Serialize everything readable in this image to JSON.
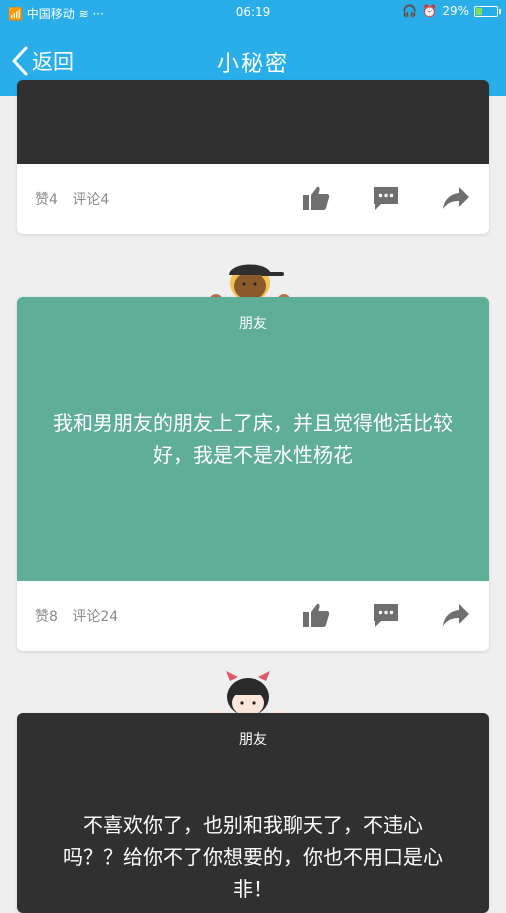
{
  "status_bar": {
    "carrier": "中国移动",
    "time": "06:19",
    "battery": "29%",
    "battery_level": 0.29
  },
  "nav": {
    "back_label": "返回",
    "title": "小秘密"
  },
  "colors": {
    "header": "#29aee9",
    "card_green": "#5fae97",
    "card_dark": "#303030",
    "icon_gray": "#6f6f6f"
  },
  "posts": [
    {
      "likes": "赞4",
      "comments": "评论4",
      "body_color": "#303030"
    },
    {
      "tag": "朋友",
      "text": "我和男朋友的朋友上了床，并且觉得他活比较好，我是不是水性杨花",
      "likes": "赞8",
      "comments": "评论24",
      "body_color": "#5fae97",
      "avatar": "boy-cap-avatar"
    },
    {
      "tag": "朋友",
      "text": "不喜欢你了，也别和我聊天了，不违心吗？？给你不了你想要的，你也不用口是心非！",
      "body_color": "#303030",
      "avatar": "girl-cat-ears-avatar"
    }
  ],
  "icons": [
    "thumbs-up-icon",
    "comment-icon",
    "share-icon",
    "back-chevron-icon",
    "wifi-icon",
    "headphones-icon",
    "alarm-icon",
    "battery-icon"
  ]
}
